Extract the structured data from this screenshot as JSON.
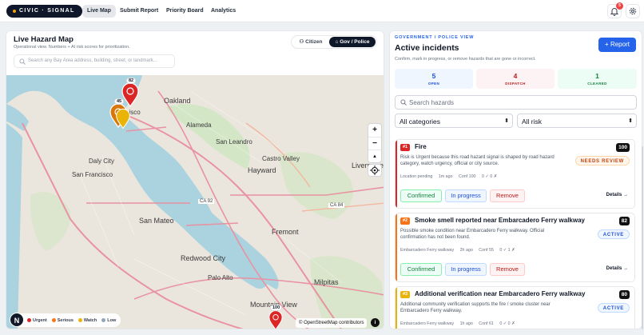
{
  "nav": {
    "logo": "CIVIC · SIGNAL",
    "links": [
      "Live Map",
      "Submit Report",
      "Priority Board",
      "Analytics"
    ],
    "notification_count": "5"
  },
  "map": {
    "title": "Live Hazard Map",
    "subtitle": "Operational view. Numbers + AI risk scores for prioritization.",
    "search_placeholder": "Search any Bay Area address, building, street, or landmark...",
    "mode_citizen": "Citizen",
    "mode_gov": "Gov / Police",
    "labels": {
      "oakland": "Oakland",
      "alameda": "Alameda",
      "sf": "San Francisco",
      "sf_short": "ncisco",
      "daly": "Daly City",
      "castro": "Castro Valley",
      "hayward": "Hayward",
      "sanleandro": "San Leandro",
      "livermore": "Livermore",
      "sanmateo": "San Mateo",
      "fremont": "Fremont",
      "redwood": "Redwood City",
      "paloalto": "Palo Alto",
      "milpitas": "Milpitas",
      "mountainview": "Mountain View",
      "ca92": "CA 92",
      "ca84": "CA 84"
    },
    "markers": {
      "m82": "82",
      "m45": "45",
      "m100": "100"
    },
    "legend": [
      "Urgent",
      "Serious",
      "Watch",
      "Low"
    ],
    "legend_colors": [
      "#dc2626",
      "#f97316",
      "#eab308",
      "#94a3b8"
    ],
    "attribution": "© OpenStreetMap contributors",
    "zoom_in": "+",
    "zoom_out": "−",
    "reset": "▲",
    "info": "i",
    "n_badge": "N"
  },
  "panel": {
    "overline": "GOVERNMENT / POLICE VIEW",
    "title": "Active incidents",
    "subtitle": "Confirm, mark in progress, or remove hazards that are gone or incorrect.",
    "report_button": "+ Report",
    "stats": [
      {
        "value": "5",
        "label": "OPEN"
      },
      {
        "value": "4",
        "label": "DISPATCH"
      },
      {
        "value": "1",
        "label": "CLEARED"
      }
    ],
    "search_placeholder": "Search hazards",
    "category_filter": "All categories",
    "risk_filter": "All risk"
  },
  "incidents": [
    {
      "rank": "#1",
      "title": "Fire",
      "score": "100",
      "desc": "Risk is Urgent because this road hazard signal is shaped by road hazard category, watch urgency, official or city source.",
      "status": "NEEDS REVIEW",
      "location": "Location pending",
      "time": "1m ago",
      "conf": "Conf 100",
      "votes": "0 ✓ 0 ✗",
      "confirm": "Confirmed",
      "progress": "In progress",
      "remove": "Remove",
      "details": "Details →"
    },
    {
      "rank": "#2",
      "title": "Smoke smell reported near Embarcadero Ferry walkway",
      "score": "82",
      "desc": "Possible smoke condition near Embarcadero Ferry walkway. Official confirmation has not been found.",
      "status": "ACTIVE",
      "location": "Embarcadero Ferry walkway",
      "time": "2h ago",
      "conf": "Conf 55",
      "votes": "0 ✓ 1 ✗",
      "confirm": "Confirmed",
      "progress": "In progress",
      "remove": "Remove",
      "details": "Details →"
    },
    {
      "rank": "#3",
      "title": "Additional verification near Embarcadero Ferry walkway",
      "score": "80",
      "desc": "Additional community verification supports the fire / smoke cluster near Embarcadero Ferry walkway.",
      "status": "ACTIVE",
      "location": "Embarcadero Ferry walkway",
      "time": "1h ago",
      "conf": "Conf 61",
      "votes": "0 ✓ 0 ✗"
    }
  ],
  "colors": {
    "accent": "#2563eb",
    "urgent": "#dc2626",
    "serious": "#f97316",
    "watch": "#eab308",
    "water": "#aad3df",
    "land": "#e9e5dc"
  }
}
